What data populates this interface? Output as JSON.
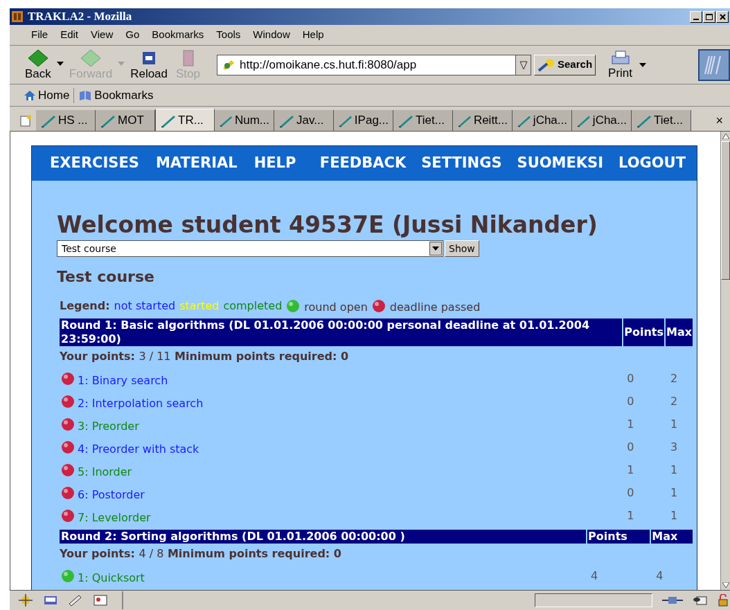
{
  "window": {
    "title": "TRAKLA2 - Mozilla"
  },
  "menu": [
    "File",
    "Edit",
    "View",
    "Go",
    "Bookmarks",
    "Tools",
    "Window",
    "Help"
  ],
  "toolbar": {
    "buttons": [
      {
        "label": "Back",
        "disabled": false,
        "dropdown": true
      },
      {
        "label": "Forward",
        "disabled": true,
        "dropdown": true
      },
      {
        "label": "Reload",
        "disabled": false,
        "dropdown": false
      },
      {
        "label": "Stop",
        "disabled": true,
        "dropdown": false
      }
    ],
    "url": "http://omoikane.cs.hut.fi:8080/app",
    "search": "Search",
    "print": "Print"
  },
  "personal_toolbar": [
    "Home",
    "Bookmarks"
  ],
  "tabs": [
    {
      "label": "HS ...",
      "selected": false
    },
    {
      "label": "MOT",
      "selected": false
    },
    {
      "label": "TR...",
      "selected": true
    },
    {
      "label": "Num...",
      "selected": false
    },
    {
      "label": "Jav...",
      "selected": false
    },
    {
      "label": "IPag...",
      "selected": false
    },
    {
      "label": "Tiet...",
      "selected": false
    },
    {
      "label": "Reitt...",
      "selected": false
    },
    {
      "label": "jCha...",
      "selected": false
    },
    {
      "label": "jCha...",
      "selected": false
    },
    {
      "label": "Tiet...",
      "selected": false
    }
  ],
  "tab_close": "×",
  "status_bar": {
    "progress": {
      "level": 0
    }
  },
  "page": {
    "nav_left": [
      "EXERCISES",
      "MATERIAL",
      "HELP"
    ],
    "nav_right": [
      "FEEDBACK",
      "SETTINGS",
      "SUOMEKSI",
      "LOGOUT"
    ],
    "welcome": "Welcome student 49537E (Jussi Nikander)",
    "course_select": "Test course",
    "show_button": "Show",
    "course_title": "Test course",
    "legend": {
      "label": "Legend:",
      "statuses": [
        {
          "label": "not started",
          "color": "#1a1aff"
        },
        {
          "label": "started",
          "color": "#ffff00"
        },
        {
          "label": "completed",
          "color": "#118811"
        }
      ],
      "round_open": "round open",
      "deadline_passed": "deadline passed"
    },
    "rounds": [
      {
        "title": "Round 1: Basic algorithms (DL 01.01.2006 00:00:00 personal deadline at 01.01.2004 23:59:00)",
        "points_header": "Points",
        "max_header": "Max",
        "deadline_passed": true,
        "your_points_label": "Your points:",
        "your_points": "3 / 11",
        "min_label": "Minimum points required: 0",
        "exercises": [
          {
            "label": "1: Binary search",
            "color": "#1a1aff",
            "points": "0",
            "max": "2"
          },
          {
            "label": "2: Interpolation search",
            "color": "#1a1aff",
            "points": "0",
            "max": "2"
          },
          {
            "label": "3: Preorder",
            "color": "#118811",
            "points": "1",
            "max": "1"
          },
          {
            "label": "4: Preorder with stack",
            "color": "#1a1aff",
            "points": "0",
            "max": "3"
          },
          {
            "label": "5: Inorder",
            "color": "#118811",
            "points": "1",
            "max": "1"
          },
          {
            "label": "6: Postorder",
            "color": "#1a1aff",
            "points": "0",
            "max": "1"
          },
          {
            "label": "7: Levelorder",
            "color": "#118811",
            "points": "1",
            "max": "1"
          }
        ]
      },
      {
        "title": "Round 2: Sorting algorithms (DL 01.01.2006 00:00:00 )",
        "points_header": "Points",
        "max_header": "Max",
        "deadline_passed": false,
        "your_points_label": "Your points:",
        "your_points": "4 / 8",
        "min_label": "Minimum points required: 0",
        "exercises": [
          {
            "label": "1: Quicksort",
            "color": "#118811",
            "points": "4",
            "max": "4"
          }
        ]
      }
    ]
  }
}
